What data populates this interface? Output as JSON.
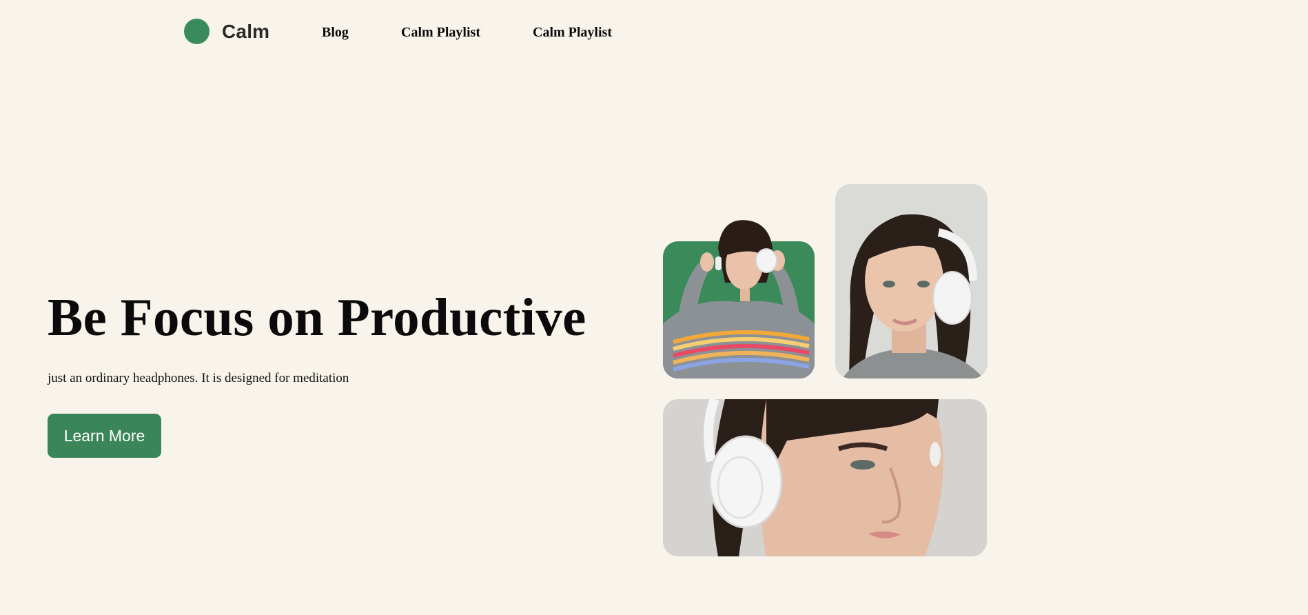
{
  "brand": {
    "name": "Calm",
    "color": "#3a8b5c"
  },
  "nav": {
    "items": [
      "Blog",
      "Calm Playlist",
      "Calm Playlist"
    ]
  },
  "hero": {
    "title": "Be Focus on Productive",
    "subtitle": "just an ordinary headphones. It is designed for meditation",
    "cta_label": "Learn More",
    "cta_color": "#3a8659"
  },
  "background": "#f8f4ec"
}
